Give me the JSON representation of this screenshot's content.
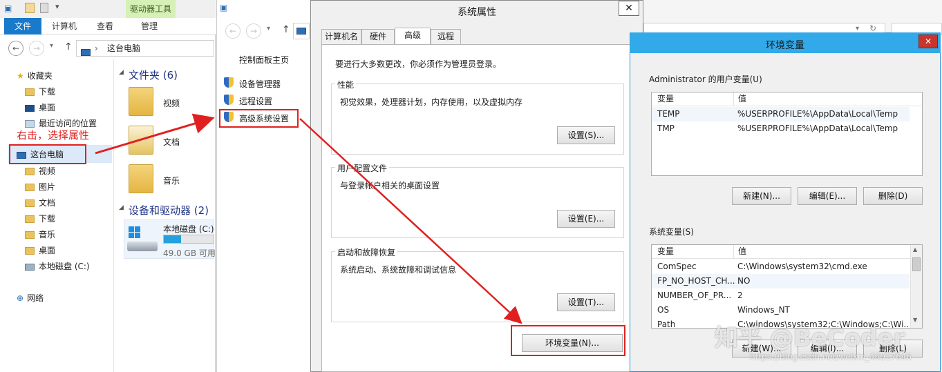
{
  "explorer": {
    "ribbon_context_tab": "驱动器工具",
    "ribbon_tabs": [
      "文件",
      "计算机",
      "查看",
      "管理"
    ],
    "address": "这台电脑",
    "tree": {
      "favorites": "收藏夹",
      "fav_items": [
        "下载",
        "桌面",
        "最近访问的位置"
      ],
      "this_pc": "这台电脑",
      "pc_items": [
        "视频",
        "图片",
        "文档",
        "下载",
        "音乐",
        "桌面"
      ],
      "local_disk": "本地磁盘 (C:)",
      "network": "网络"
    },
    "annotation": "右击，选择属性",
    "folders_heading": "文件夹 (6)",
    "folders": [
      "视频",
      "文档",
      "音乐"
    ],
    "devices_heading": "设备和驱动器 (2)",
    "drive_name": "本地磁盘 (C:)",
    "drive_free": "49.0 GB 可用",
    "drive_used_fraction": 0.35
  },
  "control_panel": {
    "home": "控制面板主页",
    "links": [
      "设备管理器",
      "远程设置",
      "高级系统设置"
    ]
  },
  "system_properties": {
    "title": "系统属性",
    "tabs": [
      "计算机名",
      "硬件",
      "高级",
      "远程"
    ],
    "active_tab": "高级",
    "admin_note": "要进行大多数更改，你必须作为管理员登录。",
    "performance": {
      "label": "性能",
      "desc": "视觉效果，处理器计划，内存使用，以及虚拟内存",
      "button": "设置(S)..."
    },
    "user_profiles": {
      "label": "用户配置文件",
      "desc": "与登录帐户相关的桌面设置",
      "button": "设置(E)..."
    },
    "startup_recovery": {
      "label": "启动和故障恢复",
      "desc": "系统启动、系统故障和调试信息",
      "button": "设置(T)..."
    },
    "env_button": "环境变量(N)..."
  },
  "env_vars": {
    "title": "环境变量",
    "user_group": "Administrator 的用户变量(U)",
    "col_var": "变量",
    "col_val": "值",
    "user_rows": [
      {
        "name": "TEMP",
        "value": "%USERPROFILE%\\AppData\\Local\\Temp"
      },
      {
        "name": "TMP",
        "value": "%USERPROFILE%\\AppData\\Local\\Temp"
      }
    ],
    "user_buttons": [
      "新建(N)...",
      "编辑(E)...",
      "删除(D)"
    ],
    "system_group": "系统变量(S)",
    "system_rows": [
      {
        "name": "ComSpec",
        "value": "C:\\Windows\\system32\\cmd.exe"
      },
      {
        "name": "FP_NO_HOST_CH...",
        "value": "NO"
      },
      {
        "name": "NUMBER_OF_PR...",
        "value": "2"
      },
      {
        "name": "OS",
        "value": "Windows_NT"
      },
      {
        "name": "Path",
        "value": "C:\\windows\\system32;C:\\Windows;C:\\Wi..."
      }
    ],
    "system_buttons": [
      "新建(W)...",
      "编辑(I)...",
      "删除(L)"
    ]
  },
  "watermark": {
    "main": "知乎 @BeCoder",
    "url": "https://blog.csdn.net/weixin_46017646"
  },
  "colors": {
    "annotation_red": "#e02020",
    "ribbon_file_blue": "#1979ca",
    "env_title_blue": "#32a9e8"
  }
}
